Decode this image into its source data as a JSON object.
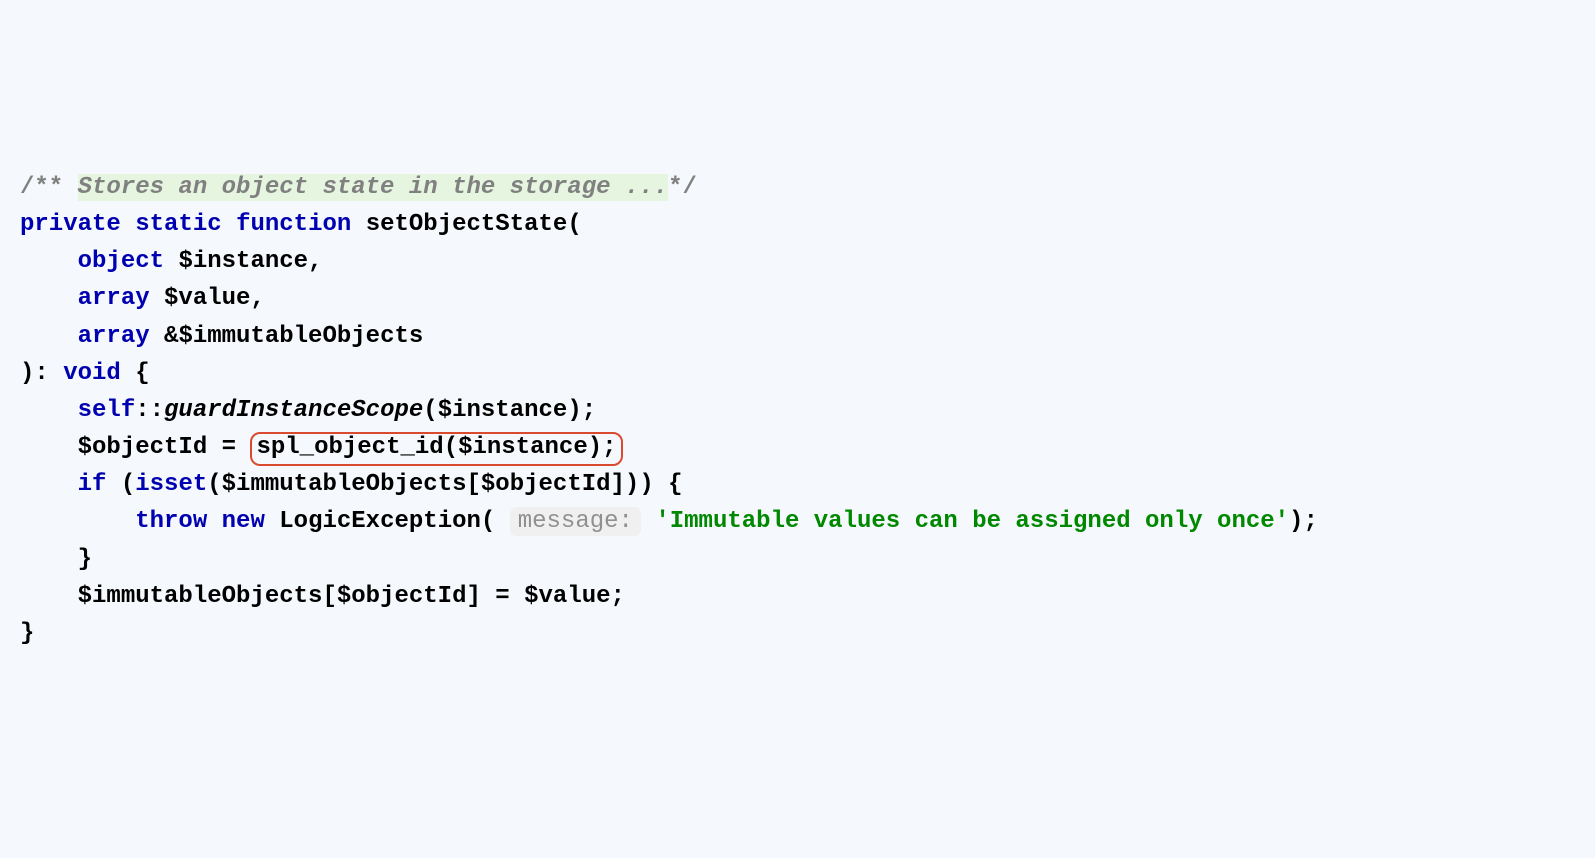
{
  "code": {
    "comment_open": "/** ",
    "comment_text": "Stores an object state in the storage ...",
    "comment_close": "*/",
    "kw_private": "private",
    "kw_static": "static",
    "kw_function": "function",
    "func_name": "setObjectState",
    "param1_type": "object",
    "param1_var": "$instance",
    "param2_type": "array",
    "param2_var": "$value",
    "param3_type": "array",
    "param3_ref": "&",
    "param3_var": "$immutableObjects",
    "return_type": "void",
    "self": "self",
    "scope_op": "::",
    "guard_call": "guardInstanceScope",
    "instance_arg": "$instance",
    "objectid_var": "$objectId",
    "spl_call": "spl_object_id",
    "kw_if": "if",
    "kw_isset": "isset",
    "immutable_var": "$immutableObjects",
    "objectid_ref": "$objectId",
    "kw_throw": "throw",
    "kw_new": "new",
    "exception_class": "LogicException",
    "hint_label": "message:",
    "string_val": "'Immutable values can be assigned only once'",
    "assign_var1": "$immutableObjects",
    "assign_idx": "$objectId",
    "assign_var2": "$value"
  }
}
